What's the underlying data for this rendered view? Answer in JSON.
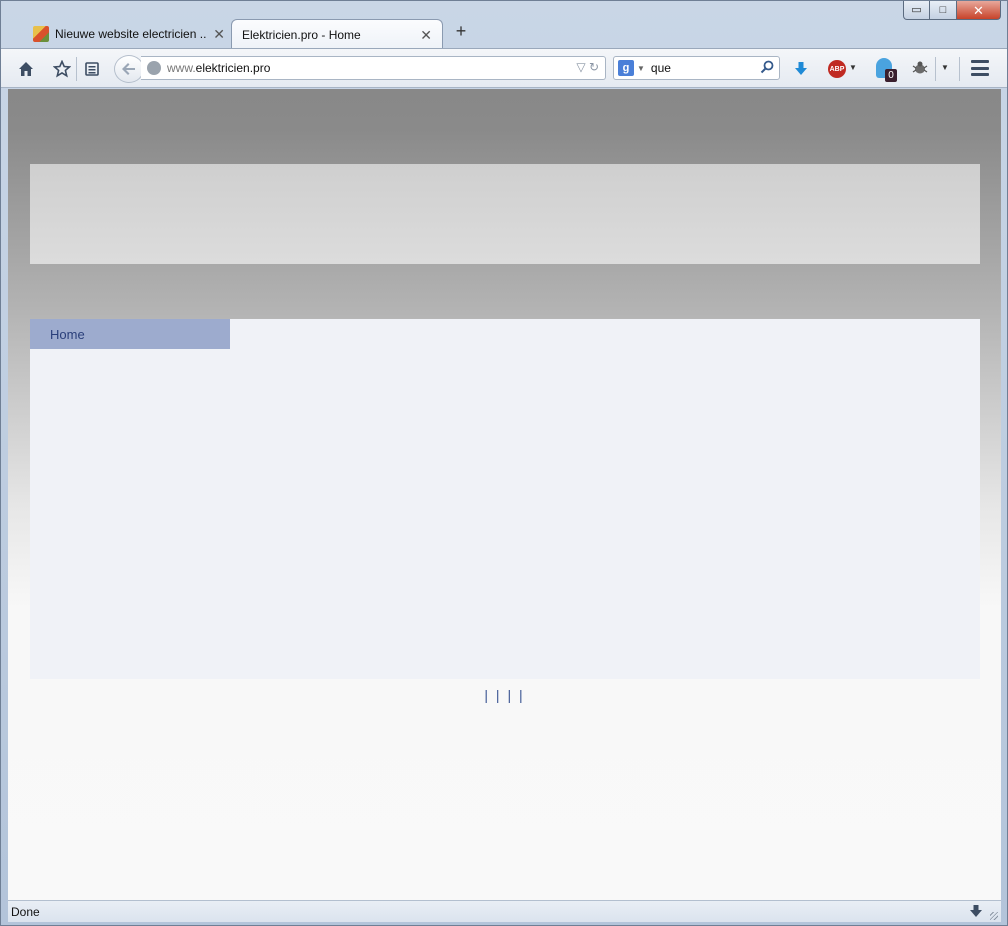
{
  "window": {
    "controls": {
      "minimize": "▭",
      "maximize": "□",
      "close": "✕"
    }
  },
  "tabs": [
    {
      "title": "Nieuwe website electricien ...",
      "close": "✕",
      "active": false
    },
    {
      "title": "Elektricien.pro - Home",
      "close": "✕",
      "active": true
    }
  ],
  "new_tab_label": "+",
  "toolbar": {
    "url_prefix": "www.",
    "url_host": "elektricien.pro",
    "url_controls": "▽ ↻",
    "search_engine": "g",
    "search_value": "que",
    "addon_badge_count": "0",
    "icons": [
      "home-icon",
      "star-icon",
      "reading-list-icon",
      "back-icon",
      "globe-icon",
      "search-icon",
      "download-icon",
      "adblock-icon",
      "ghostery-icon",
      "firebug-icon",
      "menu-icon"
    ]
  },
  "page": {
    "nav_home": "Home",
    "footer_links": "| | | |"
  },
  "status": {
    "text": "Done"
  },
  "colors": {
    "nav_bg": "#9dabce",
    "nav_text": "#2a3f7a",
    "content_bg": "#f0f2f7",
    "footer_link": "#3c5693"
  }
}
